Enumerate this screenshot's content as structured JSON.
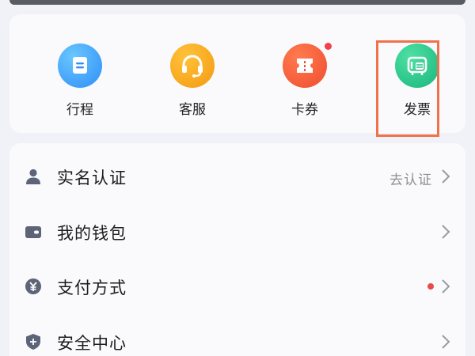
{
  "quick_actions": [
    {
      "label": "行程",
      "icon": "itinerary-icon",
      "color": "#2f8ef7"
    },
    {
      "label": "客服",
      "icon": "headset-icon",
      "color": "#f39a12"
    },
    {
      "label": "卡券",
      "icon": "coupon-icon",
      "color": "#ef4e2f",
      "badge": true
    },
    {
      "label": "发票",
      "icon": "invoice-icon",
      "color": "#19b57d",
      "highlighted": true
    }
  ],
  "menu": [
    {
      "label": "实名认证",
      "icon": "user-icon",
      "aux_text": "去认证"
    },
    {
      "label": "我的钱包",
      "icon": "wallet-icon"
    },
    {
      "label": "支付方式",
      "icon": "yuan-icon",
      "red_dot": true
    },
    {
      "label": "安全中心",
      "icon": "shield-icon"
    }
  ],
  "colors": {
    "background": "#f1f2f7",
    "card": "#fafafc",
    "highlight_border": "#f0714a",
    "badge_red": "#f0414f",
    "icon_slate": "#5d6478"
  }
}
